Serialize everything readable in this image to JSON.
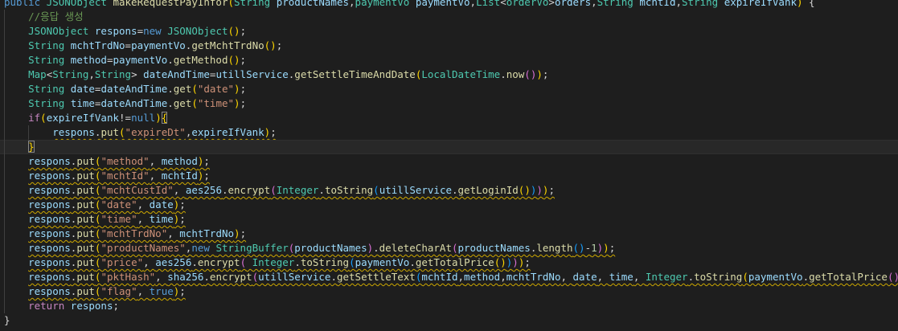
{
  "editor": {
    "theme": "dark",
    "background": "#1e1e1e",
    "warning_underline_color": "#cca700",
    "lines": [
      [
        [
          "kw",
          "public "
        ],
        [
          "ty",
          "JSONObject "
        ],
        [
          "fn",
          "makeRequestPayInfor"
        ],
        [
          "b1",
          "("
        ],
        [
          "ty",
          "String "
        ],
        [
          "var",
          "productNames"
        ],
        [
          "pl",
          ","
        ],
        [
          "ty",
          "paymentVo "
        ],
        [
          "var",
          "paymentVo"
        ],
        [
          "pl",
          ","
        ],
        [
          "ty",
          "List"
        ],
        [
          "pl",
          "<"
        ],
        [
          "ty",
          "orderVo"
        ],
        [
          "pl",
          ">"
        ],
        [
          "var",
          "orders"
        ],
        [
          "pl",
          ","
        ],
        [
          "ty",
          "String "
        ],
        [
          "var",
          "mchtId"
        ],
        [
          "pl",
          ","
        ],
        [
          "ty",
          "String "
        ],
        [
          "var",
          "expireIfVank"
        ],
        [
          "b1",
          ")"
        ],
        [
          "pl",
          " {"
        ]
      ],
      [
        [
          "cm",
          "    //응답 생성"
        ]
      ],
      [
        [
          "pl",
          "    "
        ],
        [
          "ty",
          "JSONObject "
        ],
        [
          "var",
          "respons"
        ],
        [
          "pl",
          "="
        ],
        [
          "kw",
          "new "
        ],
        [
          "ty",
          "JSONObject"
        ],
        [
          "b1",
          "("
        ],
        [
          "b1",
          ")"
        ],
        [
          "pl",
          ";"
        ]
      ],
      [
        [
          "pl",
          "    "
        ],
        [
          "ty",
          "String "
        ],
        [
          "var",
          "mchtTrdNo"
        ],
        [
          "pl",
          "="
        ],
        [
          "var",
          "paymentVo"
        ],
        [
          "pl",
          "."
        ],
        [
          "fn",
          "getMchtTrdNo"
        ],
        [
          "b1",
          "("
        ],
        [
          "b1",
          ")"
        ],
        [
          "pl",
          ";"
        ]
      ],
      [
        [
          "pl",
          "    "
        ],
        [
          "ty",
          "String "
        ],
        [
          "var",
          "method"
        ],
        [
          "pl",
          "="
        ],
        [
          "var",
          "paymentVo"
        ],
        [
          "pl",
          "."
        ],
        [
          "fn",
          "getMethod"
        ],
        [
          "b1",
          "("
        ],
        [
          "b1",
          ")"
        ],
        [
          "pl",
          ";"
        ]
      ],
      [
        [
          "pl",
          "    "
        ],
        [
          "ty",
          "Map"
        ],
        [
          "pl",
          "<"
        ],
        [
          "ty",
          "String"
        ],
        [
          "pl",
          ","
        ],
        [
          "ty",
          "String"
        ],
        [
          "pl",
          "> "
        ],
        [
          "var",
          "dateAndTime"
        ],
        [
          "pl",
          "="
        ],
        [
          "var",
          "utillService"
        ],
        [
          "pl",
          "."
        ],
        [
          "fn",
          "getSettleTimeAndDate"
        ],
        [
          "b1",
          "("
        ],
        [
          "ty",
          "LocalDateTime"
        ],
        [
          "pl",
          "."
        ],
        [
          "fn",
          "now"
        ],
        [
          "b2",
          "("
        ],
        [
          "b2",
          ")"
        ],
        [
          "b1",
          ")"
        ],
        [
          "pl",
          ";"
        ]
      ],
      [
        [
          "pl",
          "    "
        ],
        [
          "ty",
          "String "
        ],
        [
          "var",
          "date"
        ],
        [
          "pl",
          "="
        ],
        [
          "var",
          "dateAndTime"
        ],
        [
          "pl",
          "."
        ],
        [
          "fn",
          "get"
        ],
        [
          "b1",
          "("
        ],
        [
          "str",
          "\"date\""
        ],
        [
          "b1",
          ")"
        ],
        [
          "pl",
          ";"
        ]
      ],
      [
        [
          "pl",
          "    "
        ],
        [
          "ty",
          "String "
        ],
        [
          "var",
          "time"
        ],
        [
          "pl",
          "="
        ],
        [
          "var",
          "dateAndTime"
        ],
        [
          "pl",
          "."
        ],
        [
          "fn",
          "get"
        ],
        [
          "b1",
          "("
        ],
        [
          "str",
          "\"time\""
        ],
        [
          "b1",
          ")"
        ],
        [
          "pl",
          ";"
        ]
      ],
      [
        [
          "pl",
          "    "
        ],
        [
          "ctl",
          "if"
        ],
        [
          "b1",
          "("
        ],
        [
          "var",
          "expireIfVank"
        ],
        [
          "pl",
          "!="
        ],
        [
          "kw",
          "null"
        ],
        [
          "b1",
          ")"
        ],
        [
          "b1box",
          "{"
        ]
      ],
      [
        [
          "pl",
          "        "
        ],
        [
          "sq_var",
          "respons"
        ],
        [
          "sq_pl",
          "."
        ],
        [
          "sq_fn",
          "put"
        ],
        [
          "sq_b1",
          "("
        ],
        [
          "sq_str",
          "\"expireDt\""
        ],
        [
          "sq_pl",
          ","
        ],
        [
          "sq_var",
          "expireIfVank"
        ],
        [
          "sq_b1",
          ")"
        ],
        [
          "sq_pl",
          ";"
        ]
      ],
      [
        [
          "pl",
          "    "
        ],
        [
          "b1box",
          "}"
        ]
      ],
      [
        [
          "pl",
          "    "
        ],
        [
          "sq_var",
          "respons"
        ],
        [
          "sq_pl",
          "."
        ],
        [
          "sq_fn",
          "put"
        ],
        [
          "sq_b1",
          "("
        ],
        [
          "sq_str",
          "\"method\""
        ],
        [
          "sq_pl",
          ", "
        ],
        [
          "sq_var",
          "method"
        ],
        [
          "sq_b1",
          ")"
        ],
        [
          "sq_pl",
          ";"
        ]
      ],
      [
        [
          "pl",
          "    "
        ],
        [
          "sq_var",
          "respons"
        ],
        [
          "sq_pl",
          "."
        ],
        [
          "sq_fn",
          "put"
        ],
        [
          "sq_b1",
          "("
        ],
        [
          "sq_str",
          "\"mchtId\""
        ],
        [
          "sq_pl",
          ", "
        ],
        [
          "sq_var",
          "mchtId"
        ],
        [
          "sq_b1",
          ")"
        ],
        [
          "sq_pl",
          ";"
        ]
      ],
      [
        [
          "pl",
          "    "
        ],
        [
          "sq_var",
          "respons"
        ],
        [
          "sq_pl",
          "."
        ],
        [
          "sq_fn",
          "put"
        ],
        [
          "sq_b1",
          "("
        ],
        [
          "sq_str",
          "\"mchtCustId\""
        ],
        [
          "sq_pl",
          ", "
        ],
        [
          "sq_var",
          "aes256"
        ],
        [
          "sq_pl",
          "."
        ],
        [
          "sq_fn",
          "encrypt"
        ],
        [
          "sq_b2",
          "("
        ],
        [
          "sq_ty",
          "Integer"
        ],
        [
          "sq_pl",
          "."
        ],
        [
          "sq_fn",
          "toString"
        ],
        [
          "sq_b3",
          "("
        ],
        [
          "sq_var",
          "utillService"
        ],
        [
          "sq_pl",
          "."
        ],
        [
          "sq_fn",
          "getLoginId"
        ],
        [
          "sq_b1",
          "("
        ],
        [
          "sq_b1",
          ")"
        ],
        [
          "sq_b3",
          ")"
        ],
        [
          "sq_b2",
          ")"
        ],
        [
          "sq_b1",
          ")"
        ],
        [
          "sq_pl",
          ";"
        ]
      ],
      [
        [
          "pl",
          "    "
        ],
        [
          "sq_var",
          "respons"
        ],
        [
          "sq_pl",
          "."
        ],
        [
          "sq_fn",
          "put"
        ],
        [
          "sq_b1",
          "("
        ],
        [
          "sq_str",
          "\"date\""
        ],
        [
          "sq_pl",
          ", "
        ],
        [
          "sq_var",
          "date"
        ],
        [
          "sq_b1",
          ")"
        ],
        [
          "sq_pl",
          ";"
        ]
      ],
      [
        [
          "pl",
          "    "
        ],
        [
          "sq_var",
          "respons"
        ],
        [
          "sq_pl",
          "."
        ],
        [
          "sq_fn",
          "put"
        ],
        [
          "sq_b1",
          "("
        ],
        [
          "sq_str",
          "\"time\""
        ],
        [
          "sq_pl",
          ", "
        ],
        [
          "sq_var",
          "time"
        ],
        [
          "sq_b1",
          ")"
        ],
        [
          "sq_pl",
          ";"
        ]
      ],
      [
        [
          "pl",
          "    "
        ],
        [
          "sq_var",
          "respons"
        ],
        [
          "sq_pl",
          "."
        ],
        [
          "sq_fn",
          "put"
        ],
        [
          "sq_b1",
          "("
        ],
        [
          "sq_str",
          "\"mchtTrdNo\""
        ],
        [
          "sq_pl",
          ", "
        ],
        [
          "sq_var",
          "mchtTrdNo"
        ],
        [
          "sq_b1",
          ")"
        ],
        [
          "sq_pl",
          ";"
        ]
      ],
      [
        [
          "pl",
          "    "
        ],
        [
          "sq_var",
          "respons"
        ],
        [
          "sq_pl",
          "."
        ],
        [
          "sq_fn",
          "put"
        ],
        [
          "sq_b1",
          "("
        ],
        [
          "sq_str",
          "\"productNames\""
        ],
        [
          "sq_pl",
          ","
        ],
        [
          "sq_kw",
          "new "
        ],
        [
          "sq_ty",
          "StringBuffer"
        ],
        [
          "sq_b2",
          "("
        ],
        [
          "sq_var",
          "productNames"
        ],
        [
          "sq_b2",
          ")"
        ],
        [
          "sq_pl",
          "."
        ],
        [
          "sq_fn",
          "deleteCharAt"
        ],
        [
          "sq_b2",
          "("
        ],
        [
          "sq_var",
          "productNames"
        ],
        [
          "sq_pl",
          "."
        ],
        [
          "sq_fn",
          "length"
        ],
        [
          "sq_b3",
          "("
        ],
        [
          "sq_b3",
          ")"
        ],
        [
          "sq_pl",
          "-"
        ],
        [
          "sq_num",
          "1"
        ],
        [
          "sq_b2",
          ")"
        ],
        [
          "sq_b1",
          ")"
        ],
        [
          "sq_pl",
          ";"
        ]
      ],
      [
        [
          "pl",
          "    "
        ],
        [
          "sq_var",
          "respons"
        ],
        [
          "sq_pl",
          "."
        ],
        [
          "sq_fn",
          "put"
        ],
        [
          "sq_b1",
          "("
        ],
        [
          "sq_str",
          "\"price\""
        ],
        [
          "sq_pl",
          ", "
        ],
        [
          "sq_var",
          "aes256"
        ],
        [
          "sq_pl",
          "."
        ],
        [
          "sq_fn",
          "encrypt"
        ],
        [
          "sq_b2",
          "("
        ],
        [
          "sq_pl",
          " "
        ],
        [
          "sq_ty",
          "Integer"
        ],
        [
          "sq_pl",
          "."
        ],
        [
          "sq_fn",
          "toString"
        ],
        [
          "sq_b3",
          "("
        ],
        [
          "sq_var",
          "paymentVo"
        ],
        [
          "sq_pl",
          "."
        ],
        [
          "sq_fn",
          "getTotalPrice"
        ],
        [
          "sq_b1",
          "("
        ],
        [
          "sq_b1",
          ")"
        ],
        [
          "sq_b3",
          ")"
        ],
        [
          "sq_b2",
          ")"
        ],
        [
          "sq_b1",
          ")"
        ],
        [
          "sq_pl",
          ";"
        ]
      ],
      [
        [
          "pl",
          "    "
        ],
        [
          "sq_var",
          "respons"
        ],
        [
          "sq_pl",
          "."
        ],
        [
          "sq_fn",
          "put"
        ],
        [
          "sq_b1",
          "("
        ],
        [
          "sq_str",
          "\"pktHash\""
        ],
        [
          "sq_pl",
          ", "
        ],
        [
          "sq_var",
          "sha256"
        ],
        [
          "sq_pl",
          "."
        ],
        [
          "sq_fn",
          "encrypt"
        ],
        [
          "sq_b2",
          "("
        ],
        [
          "sq_var",
          "utillService"
        ],
        [
          "sq_pl",
          "."
        ],
        [
          "sq_fn",
          "getSettleText"
        ],
        [
          "sq_b3",
          "("
        ],
        [
          "sq_var",
          "mchtId"
        ],
        [
          "sq_pl",
          ","
        ],
        [
          "sq_var",
          "method"
        ],
        [
          "sq_pl",
          ","
        ],
        [
          "sq_var",
          "mchtTrdNo"
        ],
        [
          "sq_pl",
          ", "
        ],
        [
          "sq_var",
          "date"
        ],
        [
          "sq_pl",
          ", "
        ],
        [
          "sq_var",
          "time"
        ],
        [
          "sq_pl",
          ", "
        ],
        [
          "sq_ty",
          "Integer"
        ],
        [
          "sq_pl",
          "."
        ],
        [
          "sq_fn",
          "toString"
        ],
        [
          "sq_b1",
          "("
        ],
        [
          "sq_var",
          "paymentVo"
        ],
        [
          "sq_pl",
          "."
        ],
        [
          "sq_fn",
          "getTotalPrice"
        ],
        [
          "sq_b2",
          "("
        ],
        [
          "sq_b2",
          ")"
        ],
        [
          "sq_b1",
          ")"
        ],
        [
          "sq_b3",
          ")"
        ],
        [
          "sq_b2",
          ")"
        ],
        [
          "sq_b1",
          ")"
        ],
        [
          "sq_pl",
          ";"
        ]
      ],
      [
        [
          "pl",
          "    "
        ],
        [
          "sq_var",
          "respons"
        ],
        [
          "sq_pl",
          "."
        ],
        [
          "sq_fn",
          "put"
        ],
        [
          "sq_b1",
          "("
        ],
        [
          "sq_str",
          "\"flag\""
        ],
        [
          "sq_pl",
          ", "
        ],
        [
          "sq_kw",
          "true"
        ],
        [
          "sq_b1",
          ")"
        ],
        [
          "sq_pl",
          ";"
        ]
      ],
      [
        [
          "pl",
          "    "
        ],
        [
          "ctl",
          "return "
        ],
        [
          "var",
          "respons"
        ],
        [
          "pl",
          ";"
        ]
      ],
      [
        [
          "pl",
          "}"
        ]
      ]
    ]
  }
}
